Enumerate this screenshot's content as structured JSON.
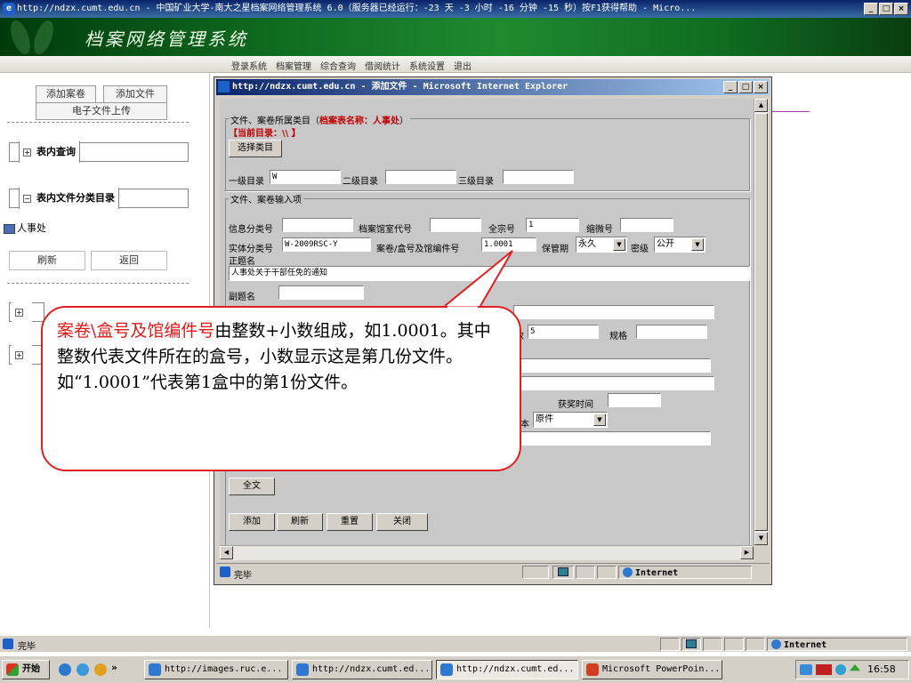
{
  "window": {
    "title": "http://ndzx.cumt.edu.cn - 中国矿业大学-南大之星档案网络管理系统 6.0（服务器已经运行：-23 天 -3 小时 -16 分钟 -15 秒）按F1获得帮助 - Micro..."
  },
  "app": {
    "title": "档案网络管理系统",
    "menu": [
      "登录系统",
      "档案管理",
      "综合查询",
      "借阅统计",
      "系统设置",
      "退出"
    ]
  },
  "sidebar": {
    "add_archive": "添加案卷",
    "add_file": "添加文件",
    "upload_electronic": "电子文件上传",
    "table_query": "表内查询",
    "category_catalog": "表内文件分类目录",
    "tree_item": "人事处",
    "refresh": "刷新",
    "back": "返回"
  },
  "dialog": {
    "title": "http://ndzx.cumt.edu.cn - 添加文件 - Microsoft Internet Explorer",
    "category_legend": "文件、案卷所属类目（",
    "archive_table_name": "档案表名称：人事处",
    "legend_close": "）",
    "current_catalog": "【当前目录：\\\\ 】",
    "select_category": "选择类目",
    "level1_label": "一级目录",
    "level1_value": "W",
    "level2_label": "二级目录",
    "level2_value": "",
    "level3_label": "三级目录",
    "level3_value": "",
    "input_legend": "文件、案卷输入项",
    "info_class_label": "信息分类号",
    "info_class_value": "",
    "archive_room_label": "档案馆室代号",
    "archive_room_value": "",
    "fonds_label": "全宗号",
    "fonds_value": "1",
    "microfilm_label": "缩微号",
    "microfilm_value": "",
    "entity_class_label": "实体分类号",
    "entity_class_value": "W-2009RSC-Y",
    "box_no_label": "案卷/盒号及馆编件号",
    "box_no_value": "1.0001",
    "retention_label": "保管期",
    "retention_value": "永久",
    "secrecy_label": "密级",
    "secrecy_value": "公开",
    "main_title_label": "正题名",
    "main_title_value": "人事处关于干部任免的通知",
    "sub_title_label": "副题名",
    "sub_title_value": "",
    "pages_label": "数",
    "pages_value": "5",
    "spec_label": "规格",
    "spec_value": "",
    "award_time_label": "获奖时间",
    "award_time_value": "",
    "text_label": "本",
    "text_value": "原件",
    "fulltext_button": "全文",
    "add_button": "添加",
    "refresh_button": "刷新",
    "reset_button": "重置",
    "close_button": "关闭",
    "status_done": "完毕",
    "status_zone": "Internet"
  },
  "callout": {
    "highlight": "案卷\\盒号及馆编件号",
    "text": "由整数+小数组成，如1.0001。其中整数代表文件所在的盒号，小数显示这是第几份文件。如“1.0001”代表第1盒中的第1份文件。"
  },
  "statusbar": {
    "done": "完毕",
    "zone": "Internet"
  },
  "taskbar": {
    "start": "开始",
    "tasks": [
      "http://images.ruc.e...",
      "http://ndzx.cumt.ed...",
      "http://ndzx.cumt.ed...",
      "Microsoft PowerPoin..."
    ],
    "clock": "16:58"
  },
  "colors": {
    "header_green": "#1f8a30",
    "callout_red": "#e02020",
    "title_blue": "#0a246a"
  }
}
